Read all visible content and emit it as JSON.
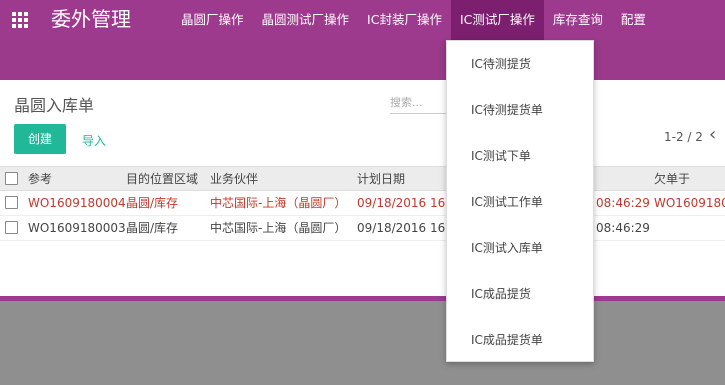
{
  "app": {
    "title": "委外管理"
  },
  "menu": {
    "items": [
      "晶圆厂操作",
      "晶圆测试厂操作",
      "IC封装厂操作",
      "IC测试厂操作",
      "库存查询",
      "配置"
    ]
  },
  "page": {
    "title": "晶圆入库单",
    "search_placeholder": "搜索...",
    "create_label": "创建",
    "import_label": "导入",
    "pager": "1-2 / 2",
    "prev_icon": "‹"
  },
  "table": {
    "columns": [
      "参考",
      "目的位置区域",
      "业务伙伴",
      "计划日期",
      "欠单于"
    ],
    "rows": [
      {
        "ref": "WO1609180004",
        "location": "晶圆/库存",
        "partner": "中芯国际-上海（晶圆厂）",
        "date": "09/18/2016 16:4",
        "time2": "08:46:29",
        "backorder": "WO1609180"
      },
      {
        "ref": "WO1609180003",
        "location": "晶圆/库存",
        "partner": "中芯国际-上海（晶圆厂）",
        "date": "09/18/2016 16:4",
        "time2": "08:46:29",
        "backorder": ""
      }
    ]
  },
  "dropdown": {
    "items": [
      "IC待测提货",
      "IC待测提货单",
      "IC测试下单",
      "IC测试工作单",
      "IC测试入库单",
      "IC成品提货",
      "IC成品提货单"
    ]
  },
  "colors": {
    "brand": "#9e3a8e",
    "accent": "#21b799",
    "warning_text": "#c0392b"
  }
}
